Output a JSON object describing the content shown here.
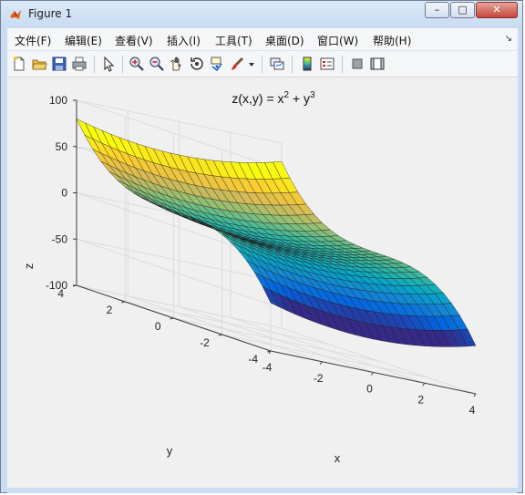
{
  "window": {
    "title": "Figure 1",
    "min_label": "–",
    "max_label": "□",
    "close_label": "✕"
  },
  "menu": [
    "文件(F)",
    "编辑(E)",
    "查看(V)",
    "插入(I)",
    "工具(T)",
    "桌面(D)",
    "窗口(W)",
    "帮助(H)"
  ],
  "menu_dock": "↘",
  "toolbar_icons": [
    "new-figure-icon",
    "open-file-icon",
    "save-icon",
    "print-icon",
    "select-arrow-icon",
    "zoom-in-icon",
    "zoom-out-icon",
    "pan-hand-icon",
    "rotate-3d-icon",
    "data-cursor-icon",
    "brush-icon",
    "brush-dropdown-icon",
    "link-plot-icon",
    "colorbar-icon",
    "legend-icon",
    "hide-plot-tools-icon",
    "show-plot-tools-icon"
  ],
  "chart_data": {
    "type": "surface",
    "title": "z(x,y) = x² + y³",
    "title_base": "z(x,y) = x",
    "title_exp1": "2",
    "title_mid": " + y",
    "title_exp2": "3",
    "xlabel": "x",
    "ylabel": "y",
    "zlabel": "z",
    "xlim": [
      -4,
      4
    ],
    "ylim": [
      -4,
      4
    ],
    "zlim": [
      -100,
      100
    ],
    "x_ticks": [
      "-4",
      "-2",
      "0",
      "2",
      "4"
    ],
    "y_ticks": [
      "-4",
      "-2",
      "0",
      "2",
      "4"
    ],
    "z_ticks": [
      "100",
      "50",
      "0",
      "-50",
      "-100"
    ],
    "grid": true,
    "colormap": "parula",
    "colormap_colors": [
      "#352a87",
      "#0363e1",
      "#1485d4",
      "#06a7c6",
      "#38b99e",
      "#92bf73",
      "#d9ba56",
      "#fcce2e",
      "#f9fb0e"
    ],
    "x_range": [
      -4,
      4
    ],
    "y_range": [
      -4,
      4
    ],
    "grid_steps": 24
  }
}
